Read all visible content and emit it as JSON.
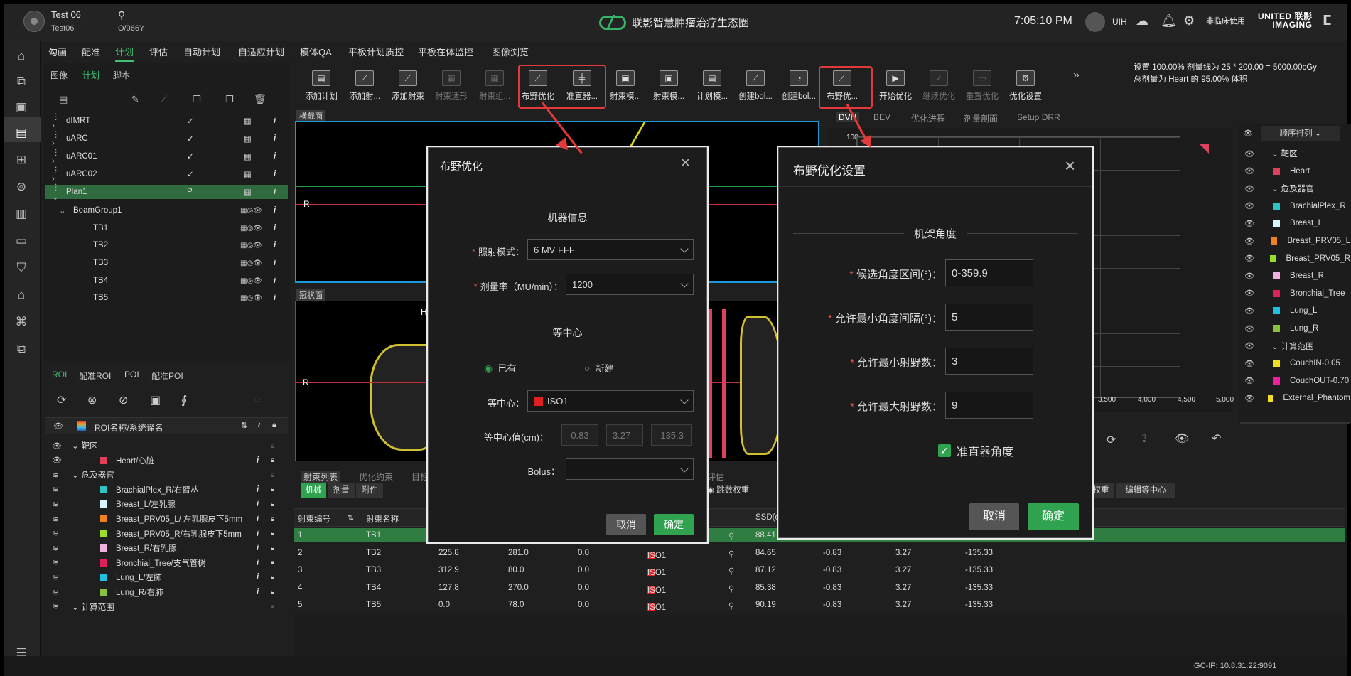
{
  "topbar": {
    "patient_name": "Test 06",
    "patient_id": "Test06",
    "patient_no": "O/066Y",
    "brand": "联影智慧肿瘤治疗生态圈",
    "time": "7:05:10 PM",
    "user": "UIH",
    "clinic_note": "非临床使用",
    "logo_line1": "UNITED 联影",
    "logo_line2": "IMAGING",
    "search_icon": "search-icon"
  },
  "menu": [
    "勾画",
    "配准",
    "计划",
    "评估",
    "自动计划",
    "自适应计划",
    "模体QA",
    "平板计划质控",
    "平板在体监控",
    "图像浏览"
  ],
  "menu_active": "计划",
  "plan_tabs": [
    "图像",
    "计划",
    "脚本"
  ],
  "plan_tree": [
    {
      "label": "dIMRT",
      "check": "✓"
    },
    {
      "label": "uARC",
      "check": "✓"
    },
    {
      "label": "uARC01",
      "check": "✓"
    },
    {
      "label": "uARC02",
      "check": "✓"
    },
    {
      "label": "Plan1",
      "check": "P"
    },
    {
      "label": "BeamGroup1",
      "check": ""
    },
    {
      "label": "TB1"
    },
    {
      "label": "TB2"
    },
    {
      "label": "TB3"
    },
    {
      "label": "TB4"
    },
    {
      "label": "TB5"
    }
  ],
  "roi_tabs": [
    "ROI",
    "配准ROI",
    "POI",
    "配准POI"
  ],
  "roi_header": "ROI名称/系统译名",
  "roi_rows": [
    {
      "label": "靶区",
      "color": "",
      "group": true
    },
    {
      "label": "Heart/心脏",
      "color": "#e0405a"
    },
    {
      "label": "危及器官",
      "color": "",
      "group": true
    },
    {
      "label": "BrachialPlex_R/右臂丛",
      "color": "#2ec4c4"
    },
    {
      "label": "Breast_L/左乳腺",
      "color": "#d8f4ff"
    },
    {
      "label": "Breast_PRV05_L/ 左乳腺皮下5mm",
      "color": "#f08020"
    },
    {
      "label": "Breast_PRV05_R/右乳腺皮下5mm",
      "color": "#9ae02a"
    },
    {
      "label": "Breast_R/右乳腺",
      "color": "#f0b0e0"
    },
    {
      "label": "Bronchial_Tree/支气管树",
      "color": "#e0205a"
    },
    {
      "label": "Lung_L/左肺",
      "color": "#20c0e0"
    },
    {
      "label": "Lung_R/右肺",
      "color": "#8ac040"
    },
    {
      "label": "计算范围",
      "color": "",
      "group": true
    }
  ],
  "toolbar": [
    {
      "label": "添加计划",
      "icon": "add-plan-icon",
      "glyph": "▤"
    },
    {
      "label": "添加射...",
      "icon": "add-beam-icon",
      "glyph": "⟋"
    },
    {
      "label": "添加射束",
      "icon": "add-beam-icon",
      "glyph": "⟋"
    },
    {
      "label": "射束适形",
      "icon": "beam-conform-icon",
      "glyph": "▦",
      "disabled": true
    },
    {
      "label": "射束组...",
      "icon": "beam-group-icon",
      "glyph": "▦",
      "disabled": true
    },
    {
      "label": "布野优化",
      "icon": "field-optimize-icon",
      "glyph": "⟋"
    },
    {
      "label": "准直器...",
      "icon": "collimator-icon",
      "glyph": "╪"
    },
    {
      "label": "射束模...",
      "icon": "beam-template-icon",
      "glyph": "▣"
    },
    {
      "label": "射束模...",
      "icon": "beam-template-icon",
      "glyph": "▣"
    },
    {
      "label": "计划模...",
      "icon": "plan-template-icon",
      "glyph": "▤"
    },
    {
      "label": "创建bol...",
      "icon": "bolus-icon",
      "glyph": "⟋"
    },
    {
      "label": "创建bol...",
      "icon": "bolus-icon",
      "glyph": "◔"
    },
    {
      "label": "布野优...",
      "icon": "field-optimize-settings-icon",
      "glyph": "⟋"
    },
    {
      "label": "开始优化",
      "icon": "start-optimize-icon",
      "glyph": "▶"
    },
    {
      "label": "继续优化",
      "icon": "continue-optimize-icon",
      "glyph": "✓",
      "disabled": true
    },
    {
      "label": "重置优化",
      "icon": "reset-optimize-icon",
      "glyph": "▭",
      "disabled": true
    },
    {
      "label": "优化设置",
      "icon": "optimize-settings-icon",
      "glyph": "⚙"
    }
  ],
  "dose_info": {
    "line1": "设置 100.00% 剂量线为 25 * 200.00 = 5000.00cGy",
    "line2": "总剂量为 Heart 的 95.00% 体积"
  },
  "view_labels": {
    "axial": "横截面",
    "coronal": "冠状面",
    "R": "R",
    "H": "H"
  },
  "right_tabs": [
    "DVH",
    "BEV",
    "优化进程",
    "剂量剖面",
    "Setup DRR"
  ],
  "dvh": {
    "y_top": "100",
    "x_ticks": [
      "3,500",
      "4,000",
      "4,500",
      "5,000"
    ]
  },
  "sort_label": "顺序排列",
  "right_rois": [
    {
      "label": "靶区",
      "color": "",
      "group": true
    },
    {
      "label": "Heart",
      "color": "#e0405a"
    },
    {
      "label": "危及器官",
      "color": "",
      "group": true
    },
    {
      "label": "BrachialPlex_R",
      "color": "#2ec4c4"
    },
    {
      "label": "Breast_L",
      "color": "#d8f4ff"
    },
    {
      "label": "Breast_PRV05_L",
      "color": "#f08020"
    },
    {
      "label": "Breast_PRV05_R",
      "color": "#9ae02a"
    },
    {
      "label": "Breast_R",
      "color": "#f0b0e0"
    },
    {
      "label": "Bronchial_Tree",
      "color": "#e0205a"
    },
    {
      "label": "Lung_L",
      "color": "#20c0e0"
    },
    {
      "label": "Lung_R",
      "color": "#8ac040"
    },
    {
      "label": "计算范围",
      "color": "",
      "group": true
    },
    {
      "label": "CouchIN-0.05",
      "color": "#f0e020"
    },
    {
      "label": "CouchOUT-0.70",
      "color": "#f020a0"
    },
    {
      "label": "External_Phantom",
      "color": "#f0e020"
    }
  ],
  "beam_tabs": [
    "射束列表",
    "优化约束",
    "目标"
  ],
  "beam_subtabs": [
    "机械",
    "剂量",
    "附件"
  ],
  "beam_extra": {
    "tab_eval": "评估",
    "radio": "跳数权重",
    "btn_weight": "权重",
    "btn_iso": "编辑等中心"
  },
  "beam_table_header": {
    "no": "射束编号",
    "name": "射束名称",
    "ssd": "SSD(c"
  },
  "beam_rows": [
    {
      "no": "1",
      "name": "TB1",
      "a": "",
      "b": "",
      "c": "",
      "iso": "",
      "ssd": "88.41",
      "x": "",
      "y": "",
      "z": ""
    },
    {
      "no": "2",
      "name": "TB2",
      "a": "225.8",
      "b": "281.0",
      "c": "0.0",
      "iso": "ISO1",
      "ssd": "84.65",
      "x": "-0.83",
      "y": "3.27",
      "z": "-135.33"
    },
    {
      "no": "3",
      "name": "TB3",
      "a": "312.9",
      "b": "80.0",
      "c": "0.0",
      "iso": "ISO1",
      "ssd": "87.12",
      "x": "-0.83",
      "y": "3.27",
      "z": "-135.33"
    },
    {
      "no": "4",
      "name": "TB4",
      "a": "127.8",
      "b": "270.0",
      "c": "0.0",
      "iso": "ISO1",
      "ssd": "85.38",
      "x": "-0.83",
      "y": "3.27",
      "z": "-135.33"
    },
    {
      "no": "5",
      "name": "TB5",
      "a": "0.0",
      "b": "78.0",
      "c": "0.0",
      "iso": "ISO1",
      "ssd": "90.19",
      "x": "-0.83",
      "y": "3.27",
      "z": "-135.33"
    }
  ],
  "dlg1": {
    "title": "布野优化",
    "sec_machine": "机器信息",
    "mode_label": "照射模式：",
    "mode_value": "6 MV FFF",
    "rate_label": "剂量率（MU/min）：",
    "rate_value": "1200",
    "sec_iso": "等中心",
    "opt_existing": "已有",
    "opt_new": "新建",
    "iso_label": "等中心：",
    "iso_value": "ISO1",
    "isoval_label": "等中心值(cm)：",
    "isoval_x": "-0.83",
    "isoval_y": "3.27",
    "isoval_z": "-135.3",
    "bolus_label": "Bolus：",
    "bolus_value": "",
    "cancel": "取消",
    "ok": "确定"
  },
  "dlg2": {
    "title": "布野优化设置",
    "sec": "机架角度",
    "f1_label": "候选角度区间(°)：",
    "f1_value": "0-359.9",
    "f2_label": "允许最小角度间隔(°)：",
    "f2_value": "5",
    "f3_label": "允许最小射野数：",
    "f3_value": "3",
    "f4_label": "允许最大射野数：",
    "f4_value": "9",
    "chk_label": "准直器角度",
    "cancel": "取消",
    "ok": "确定"
  },
  "status": {
    "ip": "IGC-IP: 10.8.31.22:9091"
  },
  "colors": {
    "accent": "#3fbf6f",
    "highlight": "#e23a3a",
    "selected_row": "#2f7d40"
  }
}
